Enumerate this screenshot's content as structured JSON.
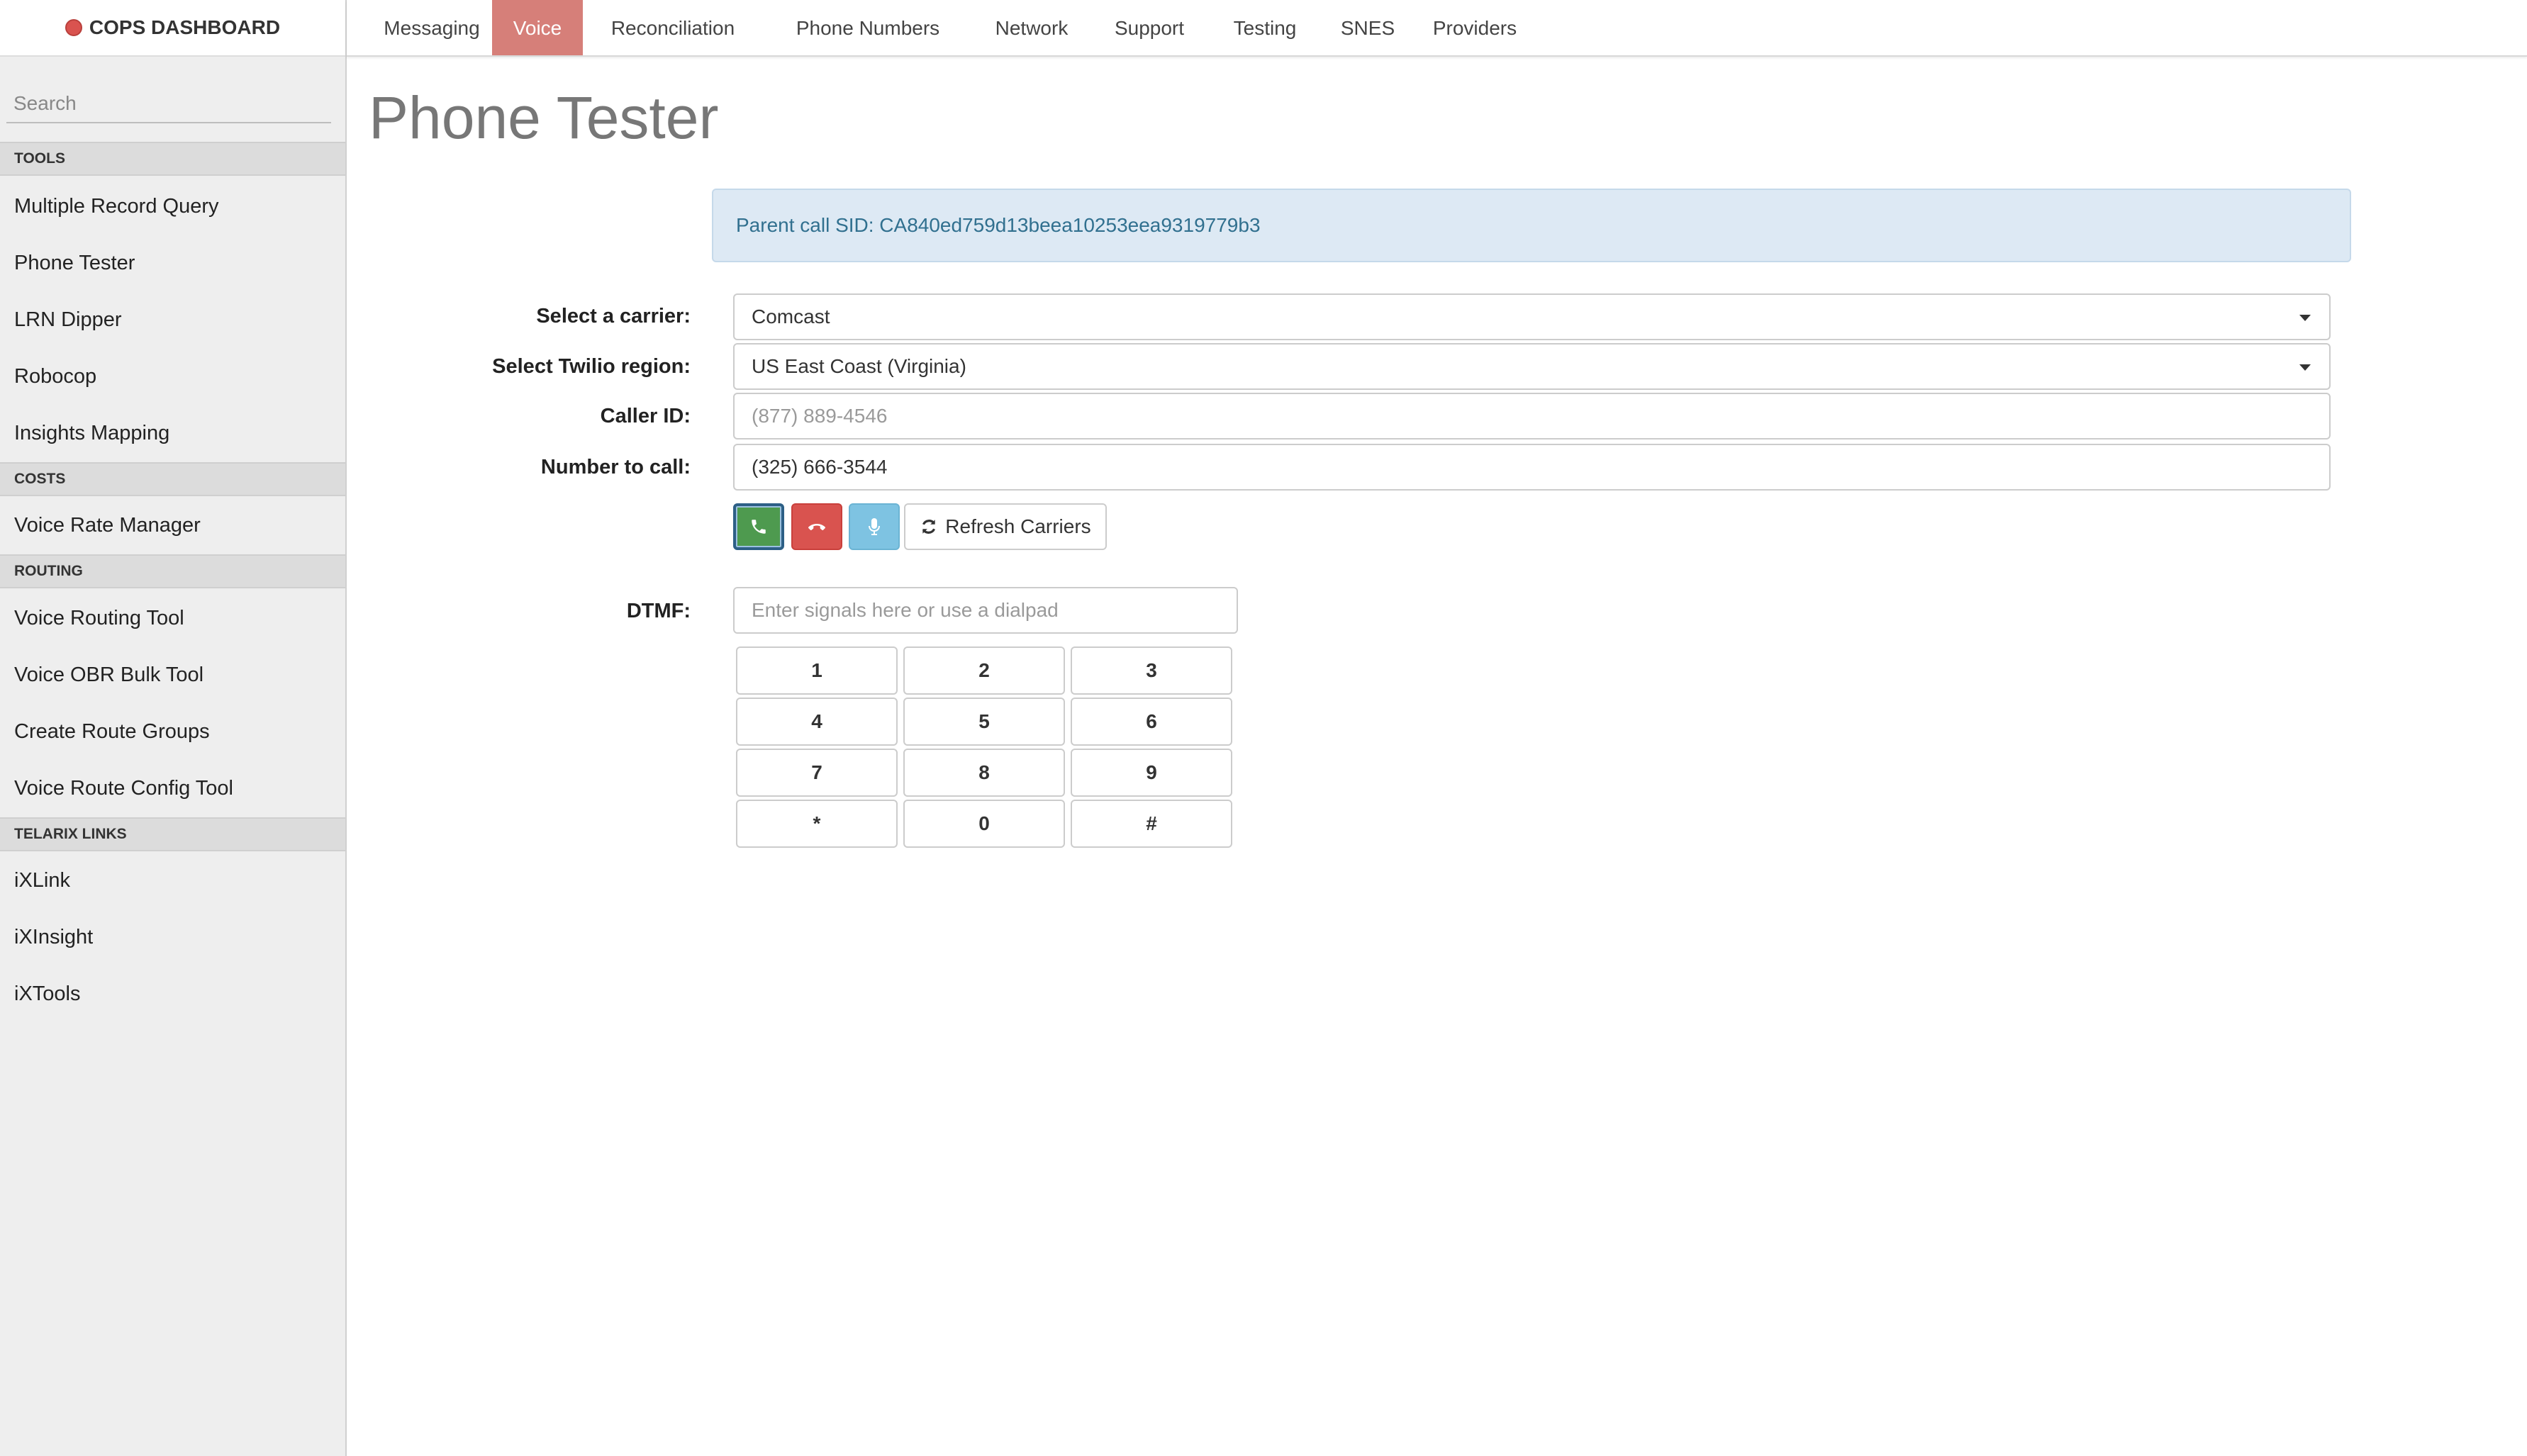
{
  "brand": {
    "title": "COPS DASHBOARD",
    "dot_color": "#d9534f"
  },
  "topnav": {
    "tabs": [
      {
        "label": "Messaging",
        "active": false
      },
      {
        "label": "Voice",
        "active": true
      },
      {
        "label": "Reconciliation",
        "active": false
      },
      {
        "label": "Phone Numbers",
        "active": false
      },
      {
        "label": "Network",
        "active": false
      },
      {
        "label": "Support",
        "active": false
      },
      {
        "label": "Testing",
        "active": false
      },
      {
        "label": "SNES",
        "active": false
      },
      {
        "label": "Providers",
        "active": false
      }
    ],
    "active_color": "#d67f79"
  },
  "sidebar": {
    "search_placeholder": "Search",
    "sections": [
      {
        "header": "TOOLS",
        "items": [
          "Multiple Record Query",
          "Phone Tester",
          "LRN Dipper",
          "Robocop",
          "Insights Mapping"
        ]
      },
      {
        "header": "COSTS",
        "items": [
          "Voice Rate Manager"
        ]
      },
      {
        "header": "ROUTING",
        "items": [
          "Voice Routing Tool",
          "Voice OBR Bulk Tool",
          "Create Route Groups",
          "Voice Route Config Tool"
        ]
      },
      {
        "header": "TELARIX LINKS",
        "items": [
          "iXLink",
          "iXInsight",
          "iXTools"
        ]
      }
    ]
  },
  "main": {
    "title": "Phone Tester",
    "alert_text": "Parent call SID: CA840ed759d13beea10253eea9319779b3",
    "form": {
      "carrier_label": "Select a carrier:",
      "carrier_value": "Comcast",
      "region_label": "Select Twilio region:",
      "region_value": "US East Coast (Virginia)",
      "caller_id_label": "Caller ID:",
      "caller_id_placeholder": "(877) 889-4546",
      "number_label": "Number to call:",
      "number_value": "(325) 666-3544"
    },
    "buttons": {
      "call_icon": "phone-icon",
      "hangup_icon": "phone-hangup-icon",
      "mic_icon": "microphone-icon",
      "refresh_label": "Refresh Carriers",
      "call_color": "#4e9a4f",
      "hangup_color": "#d9534f",
      "mic_color": "#7ec3e2"
    },
    "dtmf": {
      "label": "DTMF:",
      "placeholder": "Enter signals here or use a dialpad",
      "keys": [
        "1",
        "2",
        "3",
        "4",
        "5",
        "6",
        "7",
        "8",
        "9",
        "*",
        "0",
        "#"
      ]
    }
  }
}
